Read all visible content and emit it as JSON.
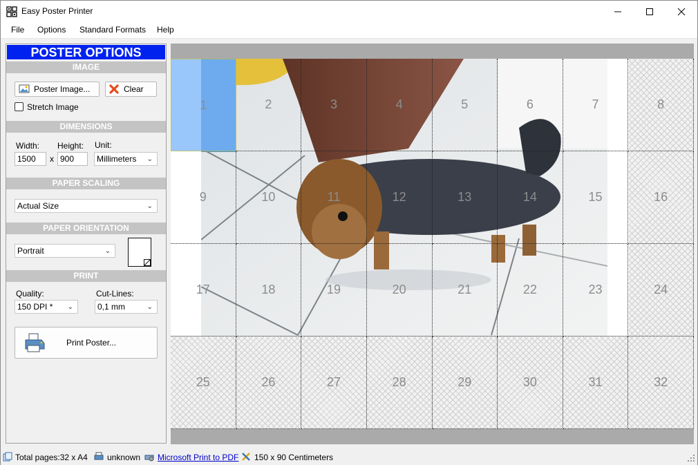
{
  "window": {
    "title": "Easy Poster Printer"
  },
  "menu": [
    "File",
    "Options",
    "Standard Formats",
    "Help"
  ],
  "panel": {
    "header": "POSTER OPTIONS",
    "image": {
      "section": "IMAGE",
      "poster_image_button": "Poster Image...",
      "clear_button": "Clear",
      "stretch_label": "Stretch Image",
      "stretch_checked": false
    },
    "dimensions": {
      "section": "DIMENSIONS",
      "width_label": "Width:",
      "height_label": "Height:",
      "unit_label": "Unit:",
      "width_value": "1500",
      "height_value": "900",
      "separator": "x",
      "unit_value": "Millimeters"
    },
    "scaling": {
      "section": "PAPER SCALING",
      "value": "Actual Size"
    },
    "orientation": {
      "section": "PAPER ORIENTATION",
      "value": "Portrait"
    },
    "print": {
      "section": "PRINT",
      "quality_label": "Quality:",
      "quality_value": "150 DPI *",
      "cutlines_label": "Cut-Lines:",
      "cutlines_value": "0,1 mm",
      "print_button": "Print Poster..."
    }
  },
  "preview": {
    "tiles": [
      "1",
      "2",
      "3",
      "4",
      "5",
      "6",
      "7",
      "8",
      "9",
      "10",
      "11",
      "12",
      "13",
      "14",
      "15",
      "16",
      "17",
      "18",
      "19",
      "20",
      "21",
      "22",
      "23",
      "24",
      "25",
      "26",
      "27",
      "28",
      "29",
      "30",
      "31",
      "32"
    ],
    "selected_tile": "1"
  },
  "status": {
    "total_pages": "Total pages:32 x A4",
    "printer_status": "unknown",
    "printer_name": "Microsoft Print to PDF",
    "poster_size": "150 x 90 Centimeters"
  },
  "colors": {
    "panel_header": "#0022ee",
    "section": "#c4c4c4",
    "selected_tile": "#78b4fa",
    "link": "#0000cc"
  }
}
